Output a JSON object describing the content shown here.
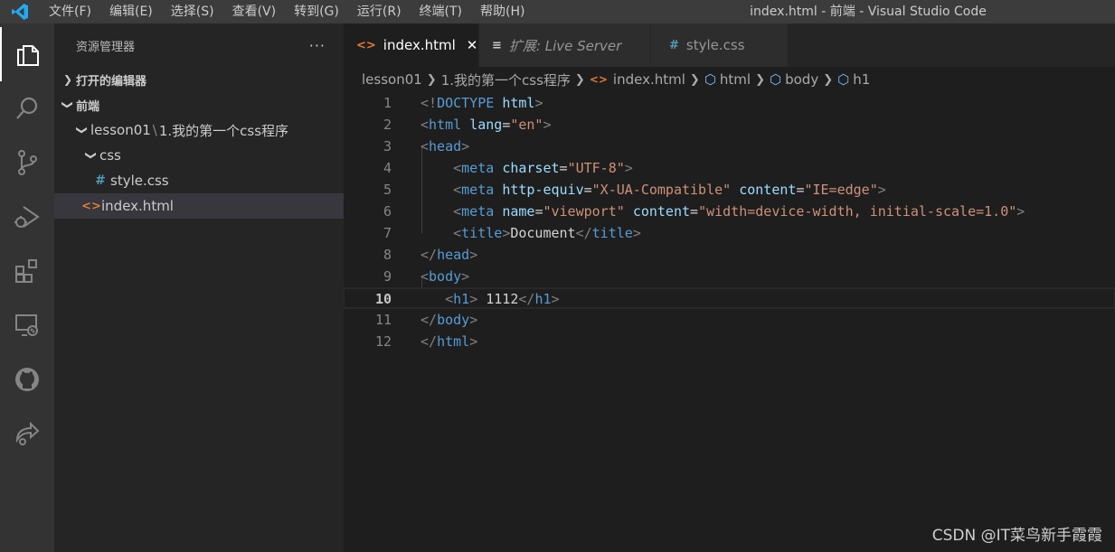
{
  "menu": [
    "文件(F)",
    "编辑(E)",
    "选择(S)",
    "查看(V)",
    "转到(G)",
    "运行(R)",
    "终端(T)",
    "帮助(H)"
  ],
  "window_title": "index.html - 前端 - Visual Studio Code",
  "sidebar": {
    "title": "资源管理器",
    "more": "···",
    "open_editors": "打开的编辑器",
    "workspace": "前端",
    "folder_a": "lesson01",
    "folder_b": "1.我的第一个css程序",
    "css_folder": "css",
    "style_file": "style.css",
    "index_file": "index.html"
  },
  "tabs": [
    {
      "label": "index.html",
      "close": "✕"
    },
    {
      "label": "扩展: Live Server"
    },
    {
      "label": "style.css"
    }
  ],
  "breadcrumb": [
    "lesson01",
    "1.我的第一个css程序",
    "index.html",
    "html",
    "body",
    "h1"
  ],
  "editor": {
    "line_numbers": [
      "1",
      "2",
      "3",
      "4",
      "5",
      "6",
      "7",
      "8",
      "9",
      "10",
      "11",
      "12"
    ],
    "current_line": "10",
    "lines": [
      [
        [
          "br",
          "<!"
        ],
        [
          "tag",
          "DOCTYPE"
        ],
        [
          "txt",
          " "
        ],
        [
          "attr",
          "html"
        ],
        [
          "br",
          ">"
        ]
      ],
      [
        [
          "br",
          "<"
        ],
        [
          "tag",
          "html"
        ],
        [
          "txt",
          " "
        ],
        [
          "attr",
          "lang"
        ],
        [
          "txt",
          "="
        ],
        [
          "str",
          "\"en\""
        ],
        [
          "br",
          ">"
        ]
      ],
      [
        [
          "br",
          "<"
        ],
        [
          "tag",
          "head"
        ],
        [
          "br",
          ">"
        ]
      ],
      [
        [
          "txt",
          "    "
        ],
        [
          "br",
          "<"
        ],
        [
          "tag",
          "meta"
        ],
        [
          "txt",
          " "
        ],
        [
          "attr",
          "charset"
        ],
        [
          "txt",
          "="
        ],
        [
          "str",
          "\"UTF-8\""
        ],
        [
          "br",
          ">"
        ]
      ],
      [
        [
          "txt",
          "    "
        ],
        [
          "br",
          "<"
        ],
        [
          "tag",
          "meta"
        ],
        [
          "txt",
          " "
        ],
        [
          "attr",
          "http-equiv"
        ],
        [
          "txt",
          "="
        ],
        [
          "str",
          "\"X-UA-Compatible\""
        ],
        [
          "txt",
          " "
        ],
        [
          "attr",
          "content"
        ],
        [
          "txt",
          "="
        ],
        [
          "str",
          "\"IE=edge\""
        ],
        [
          "br",
          ">"
        ]
      ],
      [
        [
          "txt",
          "    "
        ],
        [
          "br",
          "<"
        ],
        [
          "tag",
          "meta"
        ],
        [
          "txt",
          " "
        ],
        [
          "attr",
          "name"
        ],
        [
          "txt",
          "="
        ],
        [
          "str",
          "\"viewport\""
        ],
        [
          "txt",
          " "
        ],
        [
          "attr",
          "content"
        ],
        [
          "txt",
          "="
        ],
        [
          "str",
          "\"width=device-width, initial-scale=1.0\""
        ],
        [
          "br",
          ">"
        ]
      ],
      [
        [
          "txt",
          "    "
        ],
        [
          "br",
          "<"
        ],
        [
          "tag",
          "title"
        ],
        [
          "br",
          ">"
        ],
        [
          "txt",
          "Document"
        ],
        [
          "br",
          "</"
        ],
        [
          "tag",
          "title"
        ],
        [
          "br",
          ">"
        ]
      ],
      [
        [
          "br",
          "</"
        ],
        [
          "tag",
          "head"
        ],
        [
          "br",
          ">"
        ]
      ],
      [
        [
          "br",
          "<"
        ],
        [
          "tag",
          "body"
        ],
        [
          "br",
          ">"
        ]
      ],
      [
        [
          "txt",
          "   "
        ],
        [
          "br",
          "<"
        ],
        [
          "tag",
          "h1"
        ],
        [
          "br",
          ">"
        ],
        [
          "txt",
          " 1112"
        ],
        [
          "br",
          "</"
        ],
        [
          "tag",
          "h1"
        ],
        [
          "br",
          ">"
        ]
      ],
      [
        [
          "br",
          "</"
        ],
        [
          "tag",
          "body"
        ],
        [
          "br",
          ">"
        ]
      ],
      [
        [
          "br",
          "</"
        ],
        [
          "tag",
          "html"
        ],
        [
          "br",
          ">"
        ]
      ]
    ]
  },
  "watermark": "CSDN @IT菜鸟新手霞霞",
  "colors": {
    "accent": "#007acc",
    "tag": "#569cd6",
    "attr": "#9cdcfe",
    "string": "#ce9178",
    "html_icon": "#e37933",
    "css_icon": "#519aba"
  }
}
